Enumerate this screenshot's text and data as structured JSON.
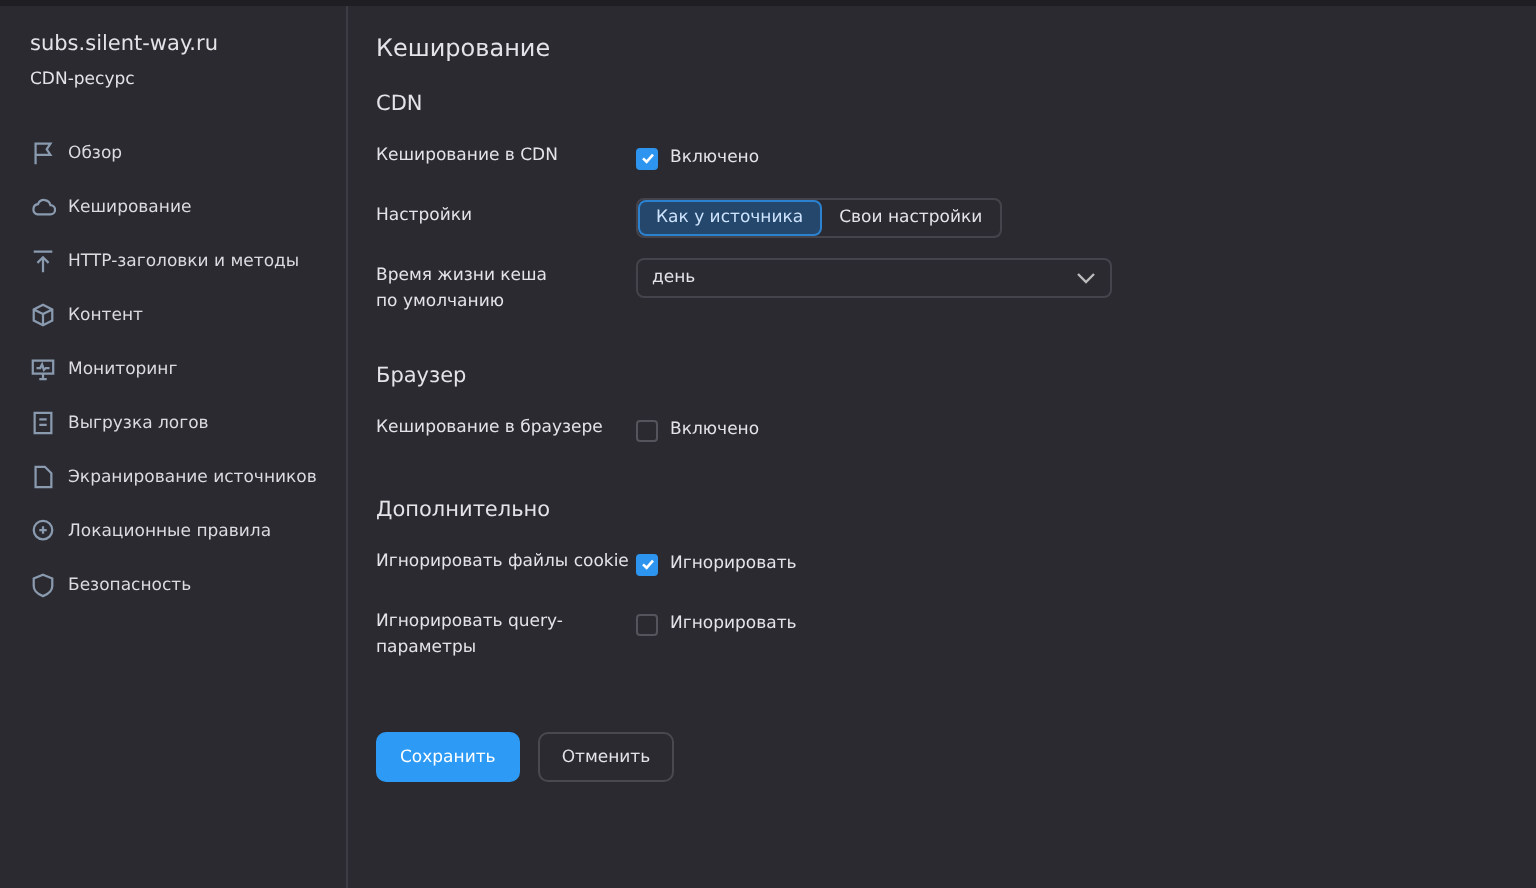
{
  "resource": {
    "name": "subs.silent-way.ru",
    "type": "CDN-ресурс"
  },
  "sidebar": {
    "items": [
      {
        "label": "Обзор"
      },
      {
        "label": "Кеширование"
      },
      {
        "label": "HTTP-заголовки и методы"
      },
      {
        "label": "Контент"
      },
      {
        "label": "Мониторинг"
      },
      {
        "label": "Выгрузка логов"
      },
      {
        "label": "Экранирование источников"
      },
      {
        "label": "Локационные правила"
      },
      {
        "label": "Безопасность"
      }
    ]
  },
  "page": {
    "title": "Кеширование"
  },
  "sections": [
    {
      "title": "CDN",
      "rows": [
        {
          "kind": "checkbox",
          "label": "Кеширование в CDN",
          "checked": true,
          "text": "Включено"
        },
        {
          "kind": "segmented",
          "label": "Настройки",
          "options": [
            {
              "label": "Как у источника",
              "selected": true
            },
            {
              "label": "Свои настройки",
              "selected": false
            }
          ]
        },
        {
          "kind": "select",
          "label": "Время жизни кеша\nпо умолчанию",
          "value": "день"
        }
      ]
    },
    {
      "title": "Браузер",
      "rows": [
        {
          "kind": "checkbox",
          "label": "Кеширование в браузере",
          "checked": false,
          "text": "Включено"
        }
      ]
    },
    {
      "title": "Дополнительно",
      "rows": [
        {
          "kind": "checkbox",
          "label": "Игнорировать файлы cookie",
          "checked": true,
          "text": "Игнорировать"
        },
        {
          "kind": "checkbox",
          "label": "Игнорировать query-\nпараметры",
          "checked": false,
          "text": "Игнорировать"
        }
      ]
    }
  ],
  "buttons": [
    {
      "label": "Сохранить",
      "kind": "primary"
    },
    {
      "label": "Отменить",
      "kind": "secondary"
    }
  ]
}
